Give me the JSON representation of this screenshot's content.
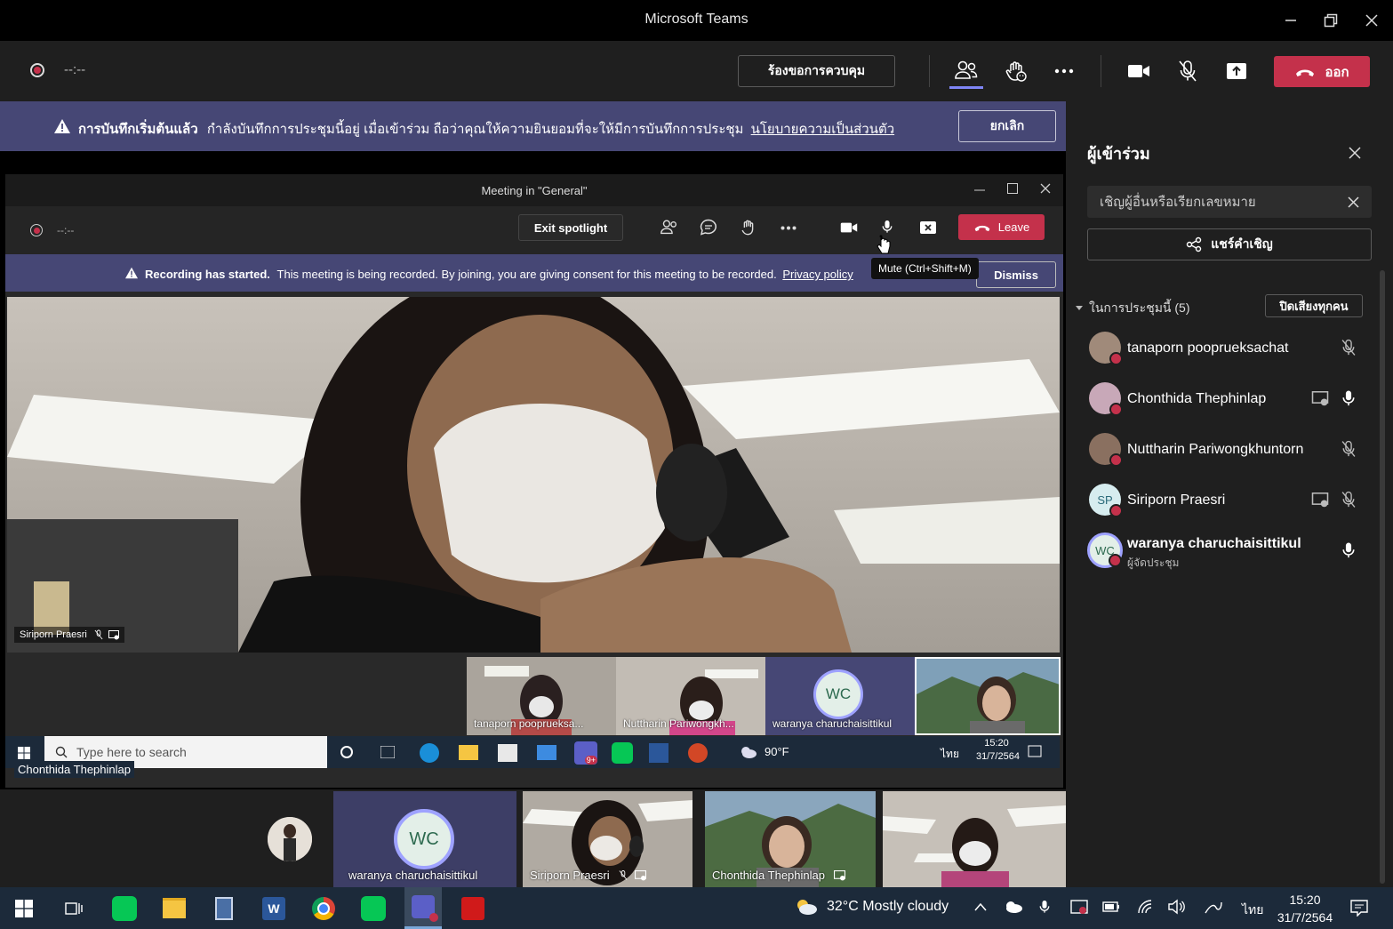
{
  "app": {
    "title": "Microsoft Teams"
  },
  "toolbar": {
    "timer": "--:--",
    "request_control": "ร้องขอการควบคุม",
    "leave": "ออก"
  },
  "banner": {
    "bold": "การบันทึกเริ่มต้นแล้ว",
    "text": "กำลังบันทึกการประชุมนี้อยู่ เมื่อเข้าร่วม ถือว่าคุณให้ความยินยอมที่จะให้มีการบันทึกการประชุม",
    "link": "นโยบายความเป็นส่วนตัว",
    "dismiss": "ยกเลิก"
  },
  "panel": {
    "title": "ผู้เข้าร่วม",
    "invite_placeholder": "เชิญผู้อื่นหรือเรียกเลขหมาย",
    "share_invite": "แชร์คำเชิญ",
    "section": "ในการประชุมนี้ (5)",
    "mute_all": "ปิดเสียงทุกคน",
    "participants": [
      {
        "name": "tanaporn pooprueksachat",
        "sub": ""
      },
      {
        "name": "Chonthida Thephinlap",
        "sub": ""
      },
      {
        "name": "Nuttharin Pariwongkhuntorn",
        "sub": ""
      },
      {
        "name": "Siriporn Praesri",
        "sub": "",
        "initials": "SP"
      },
      {
        "name": "waranya charuchaisittikul",
        "sub": "ผู้จัดประชุม",
        "initials": "WC"
      }
    ]
  },
  "inner": {
    "title": "Meeting in \"General\"",
    "timer": "--:--",
    "exit_spotlight": "Exit spotlight",
    "leave": "Leave",
    "tooltip": "Mute (Ctrl+Shift+M)",
    "banner_bold": "Recording has started.",
    "banner_text": "This meeting is being recorded. By joining, you are giving consent for this meeting to be recorded.",
    "banner_link": "Privacy policy",
    "dismiss": "Dismiss",
    "main_label": "Siriporn Praesri",
    "thumbs": [
      "tanaporn pooprueksa...",
      "Nuttharin Pariwongkh...",
      "waranya charuchaisittikul",
      ""
    ],
    "wc_initials": "WC",
    "taskbar_search": "Type here to search",
    "taskbar_weather": "90°F",
    "taskbar_lang": "ไทย",
    "taskbar_time": "15:20",
    "taskbar_date": "31/7/2564",
    "taskbar_badge": "9+",
    "self_label": "Chonthida Thephinlap"
  },
  "gallery": [
    {
      "name": "waranya charuchaisittikul",
      "initials": "WC"
    },
    {
      "name": "Siriporn Praesri"
    },
    {
      "name": "Chonthida Thephinlap"
    },
    {
      "name": ""
    }
  ],
  "taskbar": {
    "weather": "32°C  Mostly cloudy",
    "lang": "ไทย",
    "time": "15:20",
    "date": "31/7/2564"
  }
}
